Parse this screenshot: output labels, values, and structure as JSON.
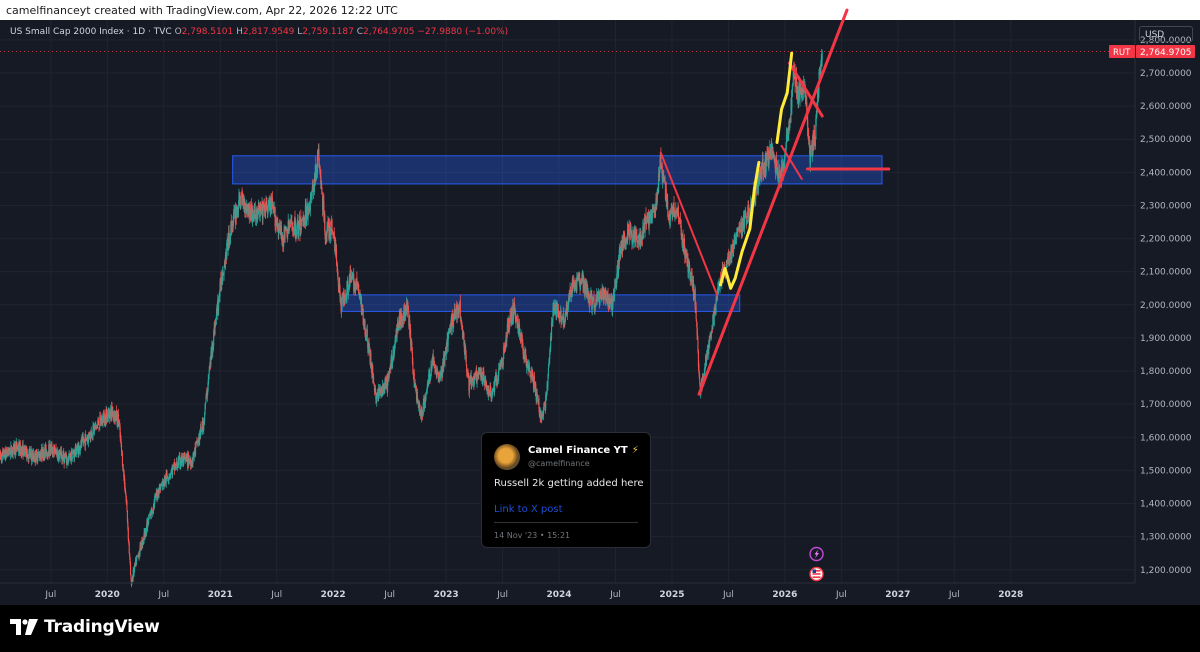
{
  "header": {
    "attribution": "camelfinanceyt created with TradingView.com, Apr 22, 2026 12:22 UTC"
  },
  "legend": {
    "symbol": "US Small Cap 2000 Index · 1D · TVC",
    "open_label": "O",
    "open": "2,798.5101",
    "high_label": "H",
    "high": "2,817.9549",
    "low_label": "L",
    "low": "2,759.1187",
    "close_label": "C",
    "close": "2,764.9705",
    "change": "−27.9880 (−1.00%)"
  },
  "currency": "USD",
  "price_tag": {
    "ticker": "RUT",
    "value": "2,764.9705"
  },
  "tweet": {
    "name": "Camel Finance YT",
    "handle": "@camelfinance",
    "text": "Russell 2k getting added here",
    "link": "Link to X post",
    "date": "14 Nov '23 • 15:21"
  },
  "brand": "TradingView",
  "colors": {
    "background": "#161a25",
    "up": "#26a69a",
    "down": "#ef5350",
    "trendline": "#f23645",
    "highlight": "#ffeb3b",
    "zone": "#2962ff"
  },
  "chart_data": {
    "type": "candlestick",
    "title": "US Small Cap 2000 Index · 1D · TVC",
    "y_axis_ticks": [
      "1,200.0000",
      "1,300.0000",
      "1,400.0000",
      "1,500.0000",
      "1,600.0000",
      "1,700.0000",
      "1,800.0000",
      "1,900.0000",
      "2,000.0000",
      "2,100.0000",
      "2,200.0000",
      "2,300.0000",
      "2,400.0000",
      "2,500.0000",
      "2,600.0000",
      "2,700.0000",
      "2,800.0000"
    ],
    "x_axis_ticks": [
      {
        "label": "Jul",
        "date": 2019.5,
        "bold": false
      },
      {
        "label": "2020",
        "date": 2020.0,
        "bold": true
      },
      {
        "label": "Jul",
        "date": 2020.5,
        "bold": false
      },
      {
        "label": "2021",
        "date": 2021.0,
        "bold": true
      },
      {
        "label": "Jul",
        "date": 2021.5,
        "bold": false
      },
      {
        "label": "2022",
        "date": 2022.0,
        "bold": true
      },
      {
        "label": "Jul",
        "date": 2022.5,
        "bold": false
      },
      {
        "label": "2023",
        "date": 2023.0,
        "bold": true
      },
      {
        "label": "Jul",
        "date": 2023.5,
        "bold": false
      },
      {
        "label": "2024",
        "date": 2024.0,
        "bold": true
      },
      {
        "label": "Jul",
        "date": 2024.5,
        "bold": false
      },
      {
        "label": "2025",
        "date": 2025.0,
        "bold": true
      },
      {
        "label": "Jul",
        "date": 2025.5,
        "bold": false
      },
      {
        "label": "2026",
        "date": 2026.0,
        "bold": true
      },
      {
        "label": "Jul",
        "date": 2026.5,
        "bold": false
      },
      {
        "label": "2027",
        "date": 2027.0,
        "bold": true
      },
      {
        "label": "Jul",
        "date": 2027.5,
        "bold": false
      },
      {
        "label": "2028",
        "date": 2028.0,
        "bold": true
      }
    ],
    "ylim": [
      1160,
      2860
    ],
    "xlim": [
      2019.05,
      2029.1
    ],
    "last_price": 2764.9705,
    "price_path": [
      [
        2019.05,
        1540
      ],
      [
        2019.2,
        1570
      ],
      [
        2019.35,
        1540
      ],
      [
        2019.5,
        1565
      ],
      [
        2019.65,
        1530
      ],
      [
        2019.8,
        1590
      ],
      [
        2019.92,
        1640
      ],
      [
        2020.04,
        1680
      ],
      [
        2020.1,
        1650
      ],
      [
        2020.17,
        1400
      ],
      [
        2020.21,
        1160
      ],
      [
        2020.26,
        1230
      ],
      [
        2020.35,
        1330
      ],
      [
        2020.45,
        1440
      ],
      [
        2020.55,
        1490
      ],
      [
        2020.65,
        1530
      ],
      [
        2020.75,
        1530
      ],
      [
        2020.85,
        1640
      ],
      [
        2020.93,
        1880
      ],
      [
        2021.02,
        2100
      ],
      [
        2021.1,
        2240
      ],
      [
        2021.18,
        2320
      ],
      [
        2021.3,
        2270
      ],
      [
        2021.45,
        2300
      ],
      [
        2021.55,
        2200
      ],
      [
        2021.62,
        2240
      ],
      [
        2021.7,
        2230
      ],
      [
        2021.8,
        2310
      ],
      [
        2021.87,
        2450
      ],
      [
        2021.93,
        2220
      ],
      [
        2022.0,
        2230
      ],
      [
        2022.07,
        2000
      ],
      [
        2022.15,
        2080
      ],
      [
        2022.22,
        2050
      ],
      [
        2022.3,
        1900
      ],
      [
        2022.38,
        1720
      ],
      [
        2022.48,
        1760
      ],
      [
        2022.58,
        1950
      ],
      [
        2022.66,
        1990
      ],
      [
        2022.72,
        1760
      ],
      [
        2022.78,
        1660
      ],
      [
        2022.88,
        1830
      ],
      [
        2022.95,
        1780
      ],
      [
        2023.05,
        1950
      ],
      [
        2023.12,
        2000
      ],
      [
        2023.2,
        1760
      ],
      [
        2023.3,
        1790
      ],
      [
        2023.4,
        1730
      ],
      [
        2023.5,
        1830
      ],
      [
        2023.55,
        1940
      ],
      [
        2023.6,
        1990
      ],
      [
        2023.68,
        1870
      ],
      [
        2023.78,
        1760
      ],
      [
        2023.84,
        1660
      ],
      [
        2023.88,
        1700
      ],
      [
        2023.95,
        1990
      ],
      [
        2024.05,
        1960
      ],
      [
        2024.12,
        2060
      ],
      [
        2024.2,
        2070
      ],
      [
        2024.3,
        2000
      ],
      [
        2024.4,
        2030
      ],
      [
        2024.47,
        2000
      ],
      [
        2024.55,
        2180
      ],
      [
        2024.62,
        2220
      ],
      [
        2024.7,
        2190
      ],
      [
        2024.77,
        2250
      ],
      [
        2024.85,
        2280
      ],
      [
        2024.9,
        2440
      ],
      [
        2024.97,
        2270
      ],
      [
        2025.05,
        2280
      ],
      [
        2025.12,
        2150
      ],
      [
        2025.2,
        2040
      ],
      [
        2025.25,
        1740
      ],
      [
        2025.33,
        1880
      ],
      [
        2025.42,
        2070
      ],
      [
        2025.5,
        2130
      ],
      [
        2025.6,
        2230
      ],
      [
        2025.7,
        2290
      ],
      [
        2025.78,
        2400
      ],
      [
        2025.88,
        2460
      ],
      [
        2025.96,
        2380
      ],
      [
        2026.0,
        2460
      ],
      [
        2026.05,
        2580
      ],
      [
        2026.08,
        2700
      ],
      [
        2026.12,
        2640
      ],
      [
        2026.18,
        2660
      ],
      [
        2026.22,
        2440
      ],
      [
        2026.27,
        2520
      ],
      [
        2026.3,
        2670
      ],
      [
        2026.33,
        2765
      ]
    ],
    "zones": [
      {
        "label": "resistance-upper",
        "x_start": 2021.11,
        "x_end": 2026.86,
        "y_low": 2365,
        "y_high": 2450
      },
      {
        "label": "support-lower",
        "x_start": 2022.08,
        "x_end": 2025.6,
        "y_low": 1980,
        "y_high": 2030
      }
    ],
    "trendlines": [
      {
        "color": "red",
        "width": 3,
        "points": [
          [
            2025.24,
            1730
          ],
          [
            2026.55,
            2890
          ]
        ]
      },
      {
        "color": "red",
        "width": 2,
        "points": [
          [
            2024.9,
            2460
          ],
          [
            2025.4,
            2030
          ]
        ]
      },
      {
        "color": "red",
        "width": 2,
        "points": [
          [
            2025.97,
            2480
          ],
          [
            2026.15,
            2380
          ]
        ]
      },
      {
        "color": "red",
        "width": 3,
        "points": [
          [
            2026.04,
            2730
          ],
          [
            2026.33,
            2570
          ]
        ]
      },
      {
        "color": "red",
        "width": 3,
        "points": [
          [
            2026.2,
            2410
          ],
          [
            2026.92,
            2410
          ]
        ]
      },
      {
        "color": "yellow",
        "width": 3,
        "points": [
          [
            2025.43,
            2060
          ],
          [
            2025.47,
            2110
          ],
          [
            2025.52,
            2050
          ],
          [
            2025.56,
            2080
          ],
          [
            2025.62,
            2160
          ],
          [
            2025.69,
            2230
          ],
          [
            2025.73,
            2350
          ],
          [
            2025.77,
            2430
          ]
        ]
      },
      {
        "color": "yellow",
        "width": 3,
        "points": [
          [
            2025.93,
            2490
          ],
          [
            2025.97,
            2590
          ],
          [
            2026.02,
            2640
          ],
          [
            2026.06,
            2760
          ]
        ]
      }
    ],
    "event_markers": [
      {
        "date": 2026.28,
        "icon": "lightning-icon"
      },
      {
        "date": 2026.28,
        "icon": "us-flag-icon"
      }
    ]
  }
}
